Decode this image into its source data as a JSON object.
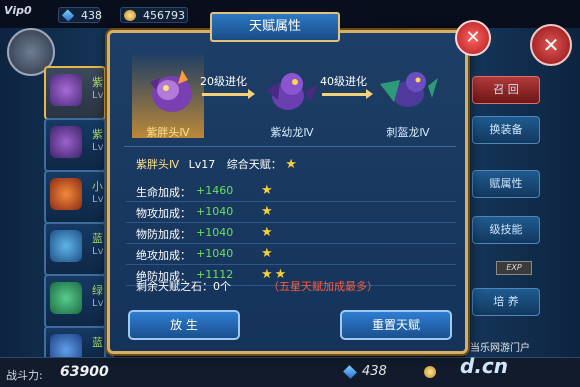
{
  "hud": {
    "vip": "Vip0",
    "gems": "438",
    "gold": "456793"
  },
  "left_list": [
    {
      "name": "紫",
      "lv": "Lv"
    },
    {
      "name": "紫",
      "lv": "Lv"
    },
    {
      "name": "小",
      "lv": "Lv"
    },
    {
      "name": "蓝",
      "lv": "Lv"
    },
    {
      "name": "绿",
      "lv": "Lv"
    },
    {
      "name": "蓝",
      "lv": ""
    }
  ],
  "right_buttons": [
    "召 回",
    "换装备",
    "赋属性",
    "级技能",
    "培 养"
  ],
  "exp_badge": "EXP",
  "modal": {
    "title": "天赋属性",
    "evolution": [
      {
        "name": "紫胖头Ⅳ"
      },
      {
        "name": "紫幼龙Ⅳ"
      },
      {
        "name": "刺盔龙Ⅳ"
      }
    ],
    "evo_labels": [
      "20级进化",
      "40级进化"
    ],
    "current": {
      "name": "紫胖头Ⅳ",
      "level": "Lv17",
      "talent_label": "综合天赋：",
      "talent_stars": 1
    },
    "stats": [
      {
        "label": "生命加成：",
        "value": "+1460",
        "stars": 1
      },
      {
        "label": "物攻加成：",
        "value": "+1040",
        "stars": 1
      },
      {
        "label": "物防加成：",
        "value": "+1040",
        "stars": 1
      },
      {
        "label": "绝攻加成：",
        "value": "+1040",
        "stars": 1
      },
      {
        "label": "绝防加成：",
        "value": "+1112",
        "stars": 2
      }
    ],
    "remaining": "剩余天赋之石：0个",
    "hint": "（五星天赋加成最多）",
    "release_label": "放 生",
    "reset_label": "重置天赋"
  },
  "bottom": {
    "power_label": "战斗力:",
    "power_value": "63900",
    "gems": "438"
  },
  "watermark": {
    "line1": "当乐网游门户",
    "line2": "d.cn"
  },
  "colors": {
    "gold_border": "#d7b066",
    "green_value": "#6be15e",
    "star": "#f7cf3d",
    "hint_red": "#ff5a3a"
  }
}
